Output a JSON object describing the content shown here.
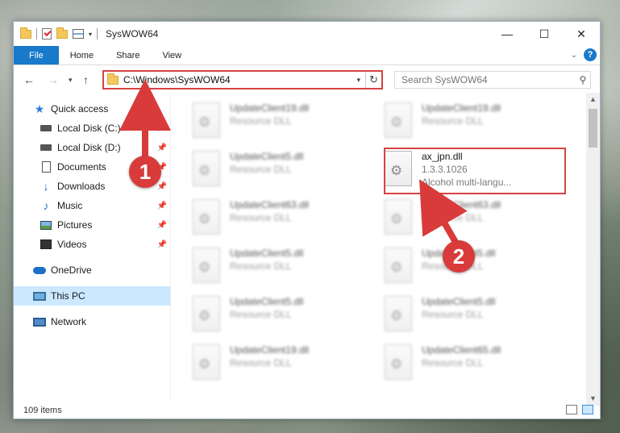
{
  "window": {
    "title": "SysWOW64",
    "controls": {
      "minimize": "—",
      "maximize": "☐",
      "close": "✕"
    }
  },
  "ribbon": {
    "tabs": [
      "File",
      "Home",
      "Share",
      "View"
    ]
  },
  "address": {
    "path": "C:\\Windows\\SysWOW64",
    "search_placeholder": "Search SysWOW64"
  },
  "sidebar": {
    "items": [
      {
        "label": "Quick access",
        "icon": "star-icon",
        "pinned": false
      },
      {
        "label": "Local Disk (C:)",
        "icon": "drive-icon",
        "pinned": true
      },
      {
        "label": "Local Disk (D:)",
        "icon": "drive-icon",
        "pinned": true
      },
      {
        "label": "Documents",
        "icon": "document-icon",
        "pinned": true
      },
      {
        "label": "Downloads",
        "icon": "download-icon",
        "pinned": true
      },
      {
        "label": "Music",
        "icon": "music-icon",
        "pinned": true
      },
      {
        "label": "Pictures",
        "icon": "picture-icon",
        "pinned": true
      },
      {
        "label": "Videos",
        "icon": "video-icon",
        "pinned": true
      },
      {
        "label": "OneDrive",
        "icon": "cloud-icon",
        "pinned": false
      },
      {
        "label": "This PC",
        "icon": "computer-icon",
        "pinned": false,
        "selected": true
      },
      {
        "label": "Network",
        "icon": "network-icon",
        "pinned": false
      }
    ]
  },
  "files": [
    {
      "name": "UpdateClient19.dll",
      "sub": "Resource DLL"
    },
    {
      "name": "UpdateClient19.dll",
      "sub": "Resource DLL"
    },
    {
      "name": "UpdateClient5.dll",
      "sub": "Resource DLL"
    },
    {
      "name": "ax_jpn.dll",
      "version": "1.3.3.1026",
      "sub": "Alcohol multi-langu...",
      "highlighted": true
    },
    {
      "name": "UpdateClient63.dll",
      "sub": "Resource DLL"
    },
    {
      "name": "UpdateClient63.dll",
      "sub": "Resource DLL"
    },
    {
      "name": "UpdateClient5.dll",
      "sub": "Resource DLL"
    },
    {
      "name": "UpdateClient5.dll",
      "sub": "Resource DLL"
    },
    {
      "name": "UpdateClient5.dll",
      "sub": "Resource DLL"
    },
    {
      "name": "UpdateClient5.dll",
      "sub": "Resource DLL"
    },
    {
      "name": "UpdateClient19.dll",
      "sub": "Resource DLL"
    },
    {
      "name": "UpdateClient65.dll",
      "sub": "Resource DLL"
    }
  ],
  "status": {
    "item_count": "109 items"
  },
  "callouts": [
    "1",
    "2"
  ],
  "colors": {
    "accent": "#1979ca",
    "annotation": "#d64242",
    "selected": "#cce8ff"
  }
}
